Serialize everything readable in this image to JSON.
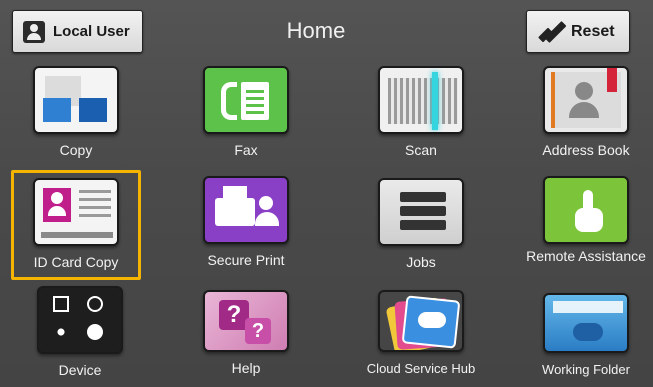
{
  "header": {
    "user_label": "Local User",
    "title": "Home",
    "reset_label": "Reset"
  },
  "apps": [
    {
      "label": "Copy",
      "icon": "copy-icon"
    },
    {
      "label": "Fax",
      "icon": "fax-icon"
    },
    {
      "label": "Scan",
      "icon": "scan-icon"
    },
    {
      "label": "Address Book",
      "icon": "address-book-icon"
    },
    {
      "label": "ID Card Copy",
      "icon": "id-card-icon",
      "selected": true
    },
    {
      "label": "Secure Print",
      "icon": "secure-print-icon"
    },
    {
      "label": "Jobs",
      "icon": "jobs-icon"
    },
    {
      "label": "Remote Assistance",
      "icon": "remote-assistance-icon"
    },
    {
      "label": "Device",
      "icon": "device-icon"
    },
    {
      "label": "Help",
      "icon": "help-icon"
    },
    {
      "label": "Cloud Service Hub",
      "icon": "cloud-service-hub-icon"
    },
    {
      "label": "Working Folder",
      "icon": "working-folder-icon"
    }
  ],
  "colors": {
    "selection": "#f5b400",
    "background": "#4a4a4a"
  }
}
